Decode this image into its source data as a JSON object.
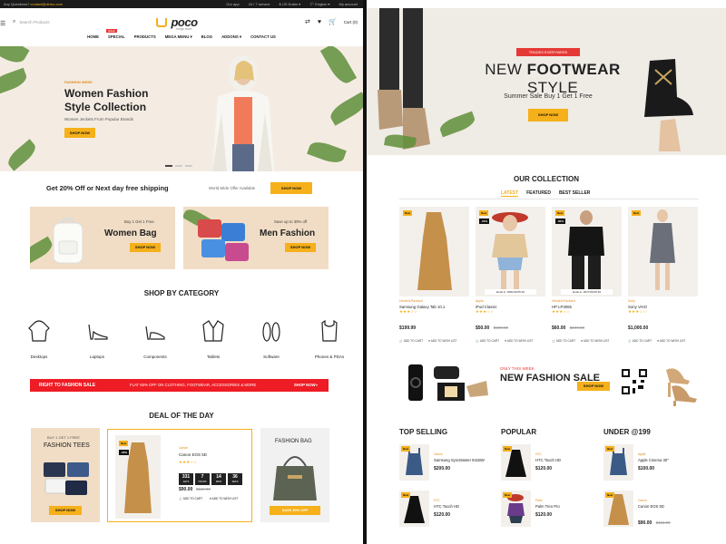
{
  "left": {
    "topbar": {
      "questions_label": "Any Questions?",
      "email": "contact@demo.com",
      "links": [
        "Our app",
        "24 / 7 service",
        "$ US Dollar ▾",
        "🏳 English ▾",
        "My account"
      ]
    },
    "header": {
      "search_placeholder": "Search Products",
      "logo": "poco",
      "logo_tagline": "mega store",
      "cart_label": "Cart (0)"
    },
    "nav": {
      "items": [
        "HOME",
        "SPECIAL",
        "PRODUCTS",
        "MEGA MENU ▾",
        "BLOG",
        "ADDONS ▾",
        "CONTACT US"
      ],
      "special_badge": "SALE"
    },
    "hero": {
      "kicker": "FASHION WEEK",
      "title": "Women Fashion Style Collection",
      "subtitle": "Women Jeckets From Popular Brands",
      "button": "SHOP NOW"
    },
    "promo": {
      "text": "Get 20% Off or Next day free shipping",
      "worldwide": "World Wide Offer Available",
      "button": "SHOP NOW"
    },
    "banners": [
      {
        "small": "Buy 1 Get 1 Free",
        "title": "Women Bag",
        "button": "SHOP NOW"
      },
      {
        "small": "Save up to 30% off",
        "title": "Men Fashion",
        "button": "SHOP NOW"
      }
    ],
    "shop_by_category": {
      "title": "SHOP BY CATEGORY",
      "items": [
        "Desktops",
        "Laptops",
        "Components",
        "Tablets",
        "Software",
        "Phones & PDAs"
      ]
    },
    "red_bar": {
      "left": "RIGHT TO FASHION SALE",
      "middle": "FLAT 60% OFF ON CLOTHING, FOOTWEAR, ACCESSORIES & MORE",
      "right": "SHOP NOW»"
    },
    "deal": {
      "title": "DEAL OF THE DAY",
      "left_card": {
        "small": "BUY 1 GET 1 FREE",
        "title": "FASHION TEES",
        "button": "SHOP NOW"
      },
      "product": {
        "tag_new": "New",
        "tag_off": "-18%",
        "brand": "Canon",
        "name": "Canon EOS 5D",
        "rating": "★★★☆☆",
        "timer": [
          {
            "value": "331",
            "unit": "DAYS"
          },
          {
            "value": "7",
            "unit": "HOURS"
          },
          {
            "value": "14",
            "unit": "MINS"
          },
          {
            "value": "36",
            "unit": "SECS"
          }
        ],
        "price": "$90.00",
        "old_price": "$110.00",
        "add_to_cart": "ADD TO CART",
        "add_to_wishlist": "ADD TO WISH LIST"
      },
      "right_card": {
        "title": "FASHION BAG",
        "button": "SAVE 30% OFF"
      }
    }
  },
  "right": {
    "hero": {
      "badge": "TRADES EVERYWEEK",
      "title_light": "NEW ",
      "title_bold": "FOOTWEAR",
      "title_end": " STYLE",
      "subtitle": "Summer Sale Buy 1 Get 1 Free",
      "button": "SHOP NOW"
    },
    "collection": {
      "title": "OUR COLLECTION",
      "tabs": [
        "LATEST",
        "FEATURED",
        "BEST SELLER"
      ],
      "products": [
        {
          "tag": "New",
          "off": "",
          "brand": "Hewlett-Packard",
          "name": "Samsung Galaxy Tab 10.1",
          "rating": "★★★☆☆",
          "price": "$199.99",
          "old": "",
          "ends": "",
          "cart": "ADD TO CART",
          "wish": "ADD TO WISH LIST"
        },
        {
          "tag": "New",
          "off": "-10%",
          "brand": "Apple",
          "name": "iPod Classic",
          "rating": "★★★☆☆",
          "price": "$50.00",
          "old": "$100.00",
          "ends": "Ends in: 328d 00:05:19",
          "cart": "ADD TO CART",
          "wish": "ADD TO WISH LIST"
        },
        {
          "tag": "New",
          "off": "-60%",
          "brand": "Hewlett-Packard",
          "name": "HP LP3065",
          "rating": "★★★☆☆",
          "price": "$60.00",
          "old": "$100.00",
          "ends": "Ends in: 297d 00:05:19",
          "cart": "ADD TO CART",
          "wish": "ADD TO WISH LIST"
        },
        {
          "tag": "New",
          "off": "",
          "brand": "Sony",
          "name": "Sony VAIO",
          "rating": "★★★☆☆",
          "price": "$1,000.00",
          "old": "",
          "ends": "",
          "cart": "ADD TO CART",
          "wish": "ADD TO WISH LIST"
        }
      ]
    },
    "sale": {
      "only": "ONLY THIS WEEK",
      "title": "NEW FASHION SALE",
      "button": "SHOP NOW"
    },
    "columns": [
      {
        "title": "TOP SELLING",
        "items": [
          {
            "tag": "New",
            "brand": "Canon",
            "name": "Samsung SyncMaster 941BW",
            "price": "$200.00",
            "old": ""
          },
          {
            "tag": "New",
            "brand": "HTC",
            "name": "HTC Touch HD",
            "price": "$120.00",
            "old": ""
          }
        ]
      },
      {
        "title": "POPULAR",
        "items": [
          {
            "tag": "New",
            "brand": "HTC",
            "name": "HTC Touch HD",
            "price": "$120.00",
            "old": ""
          },
          {
            "tag": "New",
            "brand": "Palm",
            "name": "Palm Treo Pro",
            "price": "$120.00",
            "old": ""
          }
        ]
      },
      {
        "title": "UNDER @199",
        "items": [
          {
            "tag": "New",
            "brand": "Apple",
            "name": "Apple Cinema 30\"",
            "price": "$100.00",
            "old": ""
          },
          {
            "tag": "New",
            "brand": "Canon",
            "name": "Canon EOS 5D",
            "price": "$90.00",
            "old": "$110.00"
          }
        ]
      }
    ]
  },
  "colors": {
    "accent": "#f5b01a",
    "sale_red": "#ee1c25",
    "peach": "#f1ddc5",
    "hero_bg": "#f4ece3"
  }
}
